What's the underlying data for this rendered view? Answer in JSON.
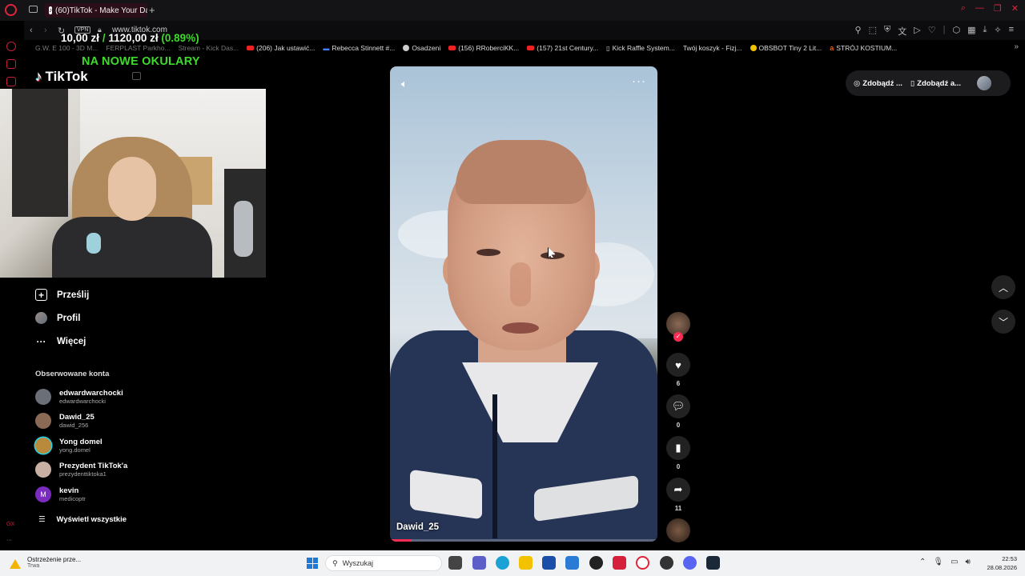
{
  "browser": {
    "tab_title": "(60)TikTok - Make Your Day",
    "tab_add": "+",
    "vpn_badge": "VPN",
    "url": "www.tiktok.com",
    "bookmarks": [
      {
        "label": "G.W. E 100 - 3D M...",
        "dim": true
      },
      {
        "label": "FERPLAST Parkho...",
        "dim": true
      },
      {
        "label": "Stream - Kick Das...",
        "dim": true
      },
      {
        "label": "(206) Jak ustawić...",
        "icon": "youtube-icon"
      },
      {
        "label": "Rebecca Stinnett #...",
        "icon": "bookmark-icon"
      },
      {
        "label": "Osadzeni",
        "icon": "globe-icon"
      },
      {
        "label": "(156) RRoberciKK...",
        "icon": "youtube-icon"
      },
      {
        "label": "(157) 21st Century...",
        "icon": "youtube-icon"
      },
      {
        "label": "Kick Raffle System...",
        "icon": "page-icon"
      },
      {
        "label": "Twój koszyk - Fizj...",
        "icon": "page-icon"
      },
      {
        "label": "OBSBOT Tiny 2 Lit...",
        "icon": "obsbot-icon"
      },
      {
        "label": "STRÓJ KOSTIUM...",
        "icon": "allegro-icon"
      }
    ]
  },
  "overlay": {
    "donation_left": "10,00 zł",
    "donation_sep": "/",
    "donation_right": "1120,00 zł",
    "donation_pct": "(0.89%)",
    "goal_text": "NA NOWE OKULARY"
  },
  "tiktok": {
    "logo": "TikTok",
    "nav": {
      "upload": "Prześlij",
      "profile": "Profil",
      "more": "Więcej"
    },
    "followed_title": "Obserwowane konta",
    "accounts": [
      {
        "name": "edwardwarchocki",
        "username": "edwardwarchocki",
        "avatar_color": "#6b6f78"
      },
      {
        "name": "Dawid_25",
        "username": "dawid_256",
        "avatar_color": "#8a6a55"
      },
      {
        "name": "Yong domel",
        "username": "yong.domel",
        "avatar_color": "#b98a3c"
      },
      {
        "name": "Prezydent TikTok'a",
        "username": "prezydenttiktoka1",
        "avatar_color": "#c9b0a5"
      },
      {
        "name": "kevin",
        "username": "medicoptr",
        "avatar_letter": "M",
        "avatar_color": "#7b2bbf"
      }
    ],
    "see_all": "Wyświetl wszystkie",
    "header_buttons": {
      "get_coins": "Zdobądź ...",
      "get_app": "Zdobądź a..."
    },
    "video": {
      "author": "Dawid_25",
      "progress": 0.08
    },
    "actions": {
      "likes": "6",
      "comments": "0",
      "saves": "0",
      "shares": "11"
    }
  },
  "taskbar": {
    "notification_title": "Ostrzeżenie prze...",
    "notification_sub": "Trwa",
    "search_placeholder": "Wyszukaj",
    "time": "22:53",
    "date": "28.08.2026"
  },
  "colors": {
    "accent": "#fe2c55",
    "opera_red": "#e0253b",
    "overlay_green": "#3ddc2a"
  }
}
